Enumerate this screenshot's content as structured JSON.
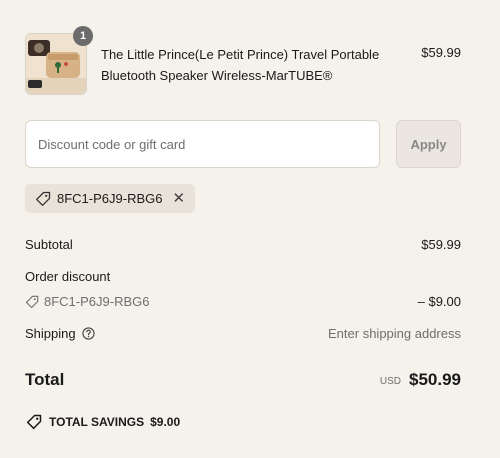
{
  "line_item": {
    "quantity": "1",
    "name": "The Little Prince(Le Petit Prince) Travel Portable Bluetooth Speaker Wireless-MarTUBE®",
    "price": "$59.99",
    "thumbnail_icon": "product-thumbnail"
  },
  "discount": {
    "placeholder": "Discount code or gift card",
    "apply_label": "Apply",
    "applied_code": "8FC1-P6J9-RBG6",
    "remove_icon": "close-icon"
  },
  "summary": {
    "subtotal_label": "Subtotal",
    "subtotal_value": "$59.99",
    "order_discount_label": "Order discount",
    "order_discount_code": "8FC1-P6J9-RBG6",
    "order_discount_value": "– $9.00",
    "shipping_label": "Shipping",
    "shipping_value": "Enter shipping address",
    "total_label": "Total",
    "total_currency": "USD",
    "total_value": "$50.99",
    "savings_label": "TOTAL SAVINGS",
    "savings_value": "$9.00"
  },
  "colors": {
    "background": "#f5f2ec",
    "chip": "#e9e2d8",
    "badge": "#6b6b6b"
  }
}
